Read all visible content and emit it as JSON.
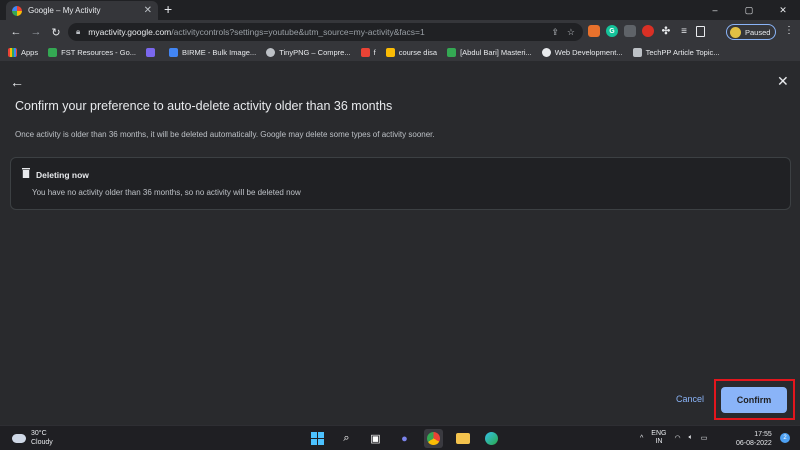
{
  "browser": {
    "tab_title": "Google – My Activity",
    "new_tab": "+",
    "url_host": "myactivity.google.com",
    "url_path": "/activitycontrols?settings=youtube&utm_source=my-activity&facs=1",
    "profile_status": "Paused",
    "window_controls": [
      "–",
      "▢",
      "✕"
    ]
  },
  "bookmarks": [
    {
      "label": "Apps",
      "color": "#e8eaed"
    },
    {
      "label": "FST Resources - Go...",
      "color": "#34a853"
    },
    {
      "label": "",
      "color": "#7b68ee"
    },
    {
      "label": "BIRME - Bulk Image...",
      "color": "#4285f4"
    },
    {
      "label": "TinyPNG – Compre...",
      "color": "#bdc1c6"
    },
    {
      "label": "f",
      "color": "#ea4335"
    },
    {
      "label": "course disa",
      "color": "#fbbc05"
    },
    {
      "label": "[Abdul Bari] Masteri...",
      "color": "#34a853"
    },
    {
      "label": "Web Development...",
      "color": "#e8eaed"
    },
    {
      "label": "TechPP Article Topic...",
      "color": "#bdc1c6"
    }
  ],
  "dialog": {
    "heading": "Confirm your preference to auto-delete activity older than 36 months",
    "description": "Once activity is older than 36 months, it will be deleted automatically. Google may delete some types of activity sooner.",
    "card_title": "Deleting now",
    "card_body": "You have no activity older than 36 months, so no activity will be deleted now",
    "cancel_label": "Cancel",
    "confirm_label": "Confirm"
  },
  "taskbar": {
    "temperature": "30°C",
    "weather": "Cloudy",
    "lang": "ENG",
    "region": "IN",
    "time": "17:55",
    "date": "06-08-2022",
    "notifications": "2"
  }
}
